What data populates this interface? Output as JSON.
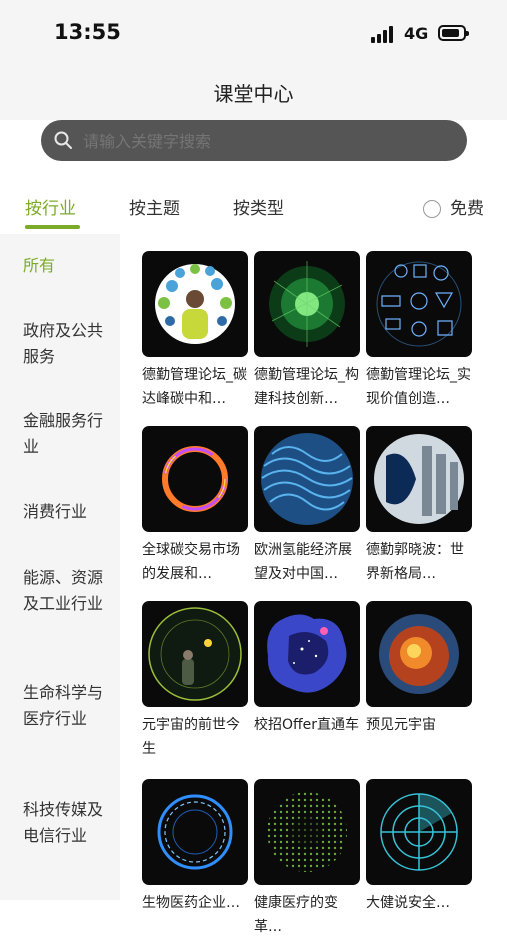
{
  "status": {
    "time": "13:55",
    "network": "4G"
  },
  "header": {
    "title": "课堂中心"
  },
  "search": {
    "placeholder": "请输入关键字搜索"
  },
  "tabs": [
    {
      "label": "按行业",
      "active": true
    },
    {
      "label": "按主题",
      "active": false
    },
    {
      "label": "按类型",
      "active": false
    }
  ],
  "free_filter": {
    "label": "免费",
    "checked": false
  },
  "sidebar": {
    "items": [
      {
        "label": "所有",
        "active": true
      },
      {
        "label": "政府及公共服务"
      },
      {
        "label": "金融服务行业"
      },
      {
        "label": "消费行业"
      },
      {
        "label": "能源、资源及工业行业"
      },
      {
        "label": "生命科学与医疗行业"
      },
      {
        "label": "科技传媒及电信行业"
      }
    ]
  },
  "courses": [
    {
      "title": "德勤管理论坛_碳达峰碳中和…",
      "icon": "people-icons-thumbnail"
    },
    {
      "title": "德勤管理论坛_构建科技创新…",
      "icon": "green-network-thumbnail"
    },
    {
      "title": "德勤管理论坛_实现价值创造…",
      "icon": "tech-pattern-thumbnail"
    },
    {
      "title": "全球碳交易市场的发展和…",
      "icon": "neon-ring-thumbnail"
    },
    {
      "title": "欧洲氢能经济展望及对中国…",
      "icon": "blue-waves-thumbnail"
    },
    {
      "title": "德勤郭晓波：世界新格局…",
      "icon": "building-circle-thumbnail"
    },
    {
      "title": "元宇宙的前世今生",
      "icon": "planet-person-thumbnail"
    },
    {
      "title": "校招Offer直通车",
      "icon": "space-blob-thumbnail"
    },
    {
      "title": "预见元宇宙",
      "icon": "fire-planet-thumbnail"
    },
    {
      "title": "生物医药企业…",
      "icon": "blue-ring-thumbnail"
    },
    {
      "title": "健康医疗的变革…",
      "icon": "green-dots-thumbnail"
    },
    {
      "title": "大健说安全…",
      "icon": "radar-thumbnail"
    }
  ],
  "colors": {
    "accent": "#7cab2a",
    "search_bg": "#555555",
    "sidebar_bg": "#f5f5f5"
  }
}
